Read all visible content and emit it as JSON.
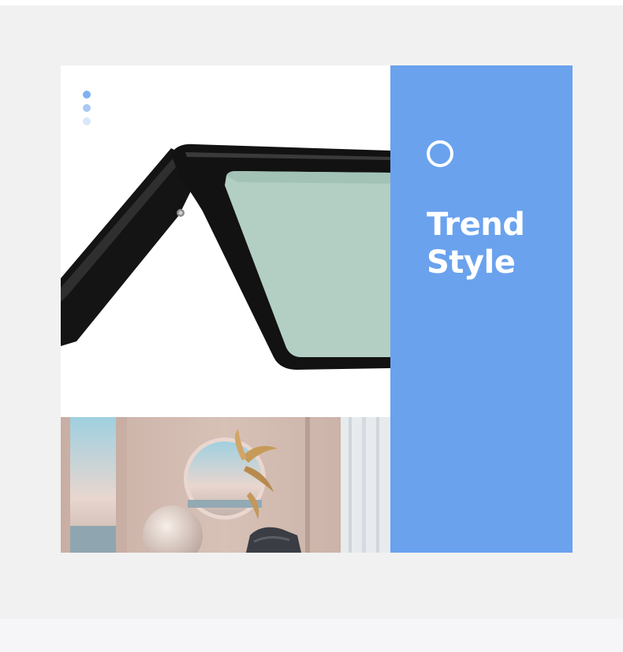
{
  "colors": {
    "accent": "#6aa2ee",
    "page_background": "#f1f1f1",
    "dot_1": "#7fb0f0",
    "dot_2": "#a9c9f5",
    "dot_3": "#d8e7fb"
  },
  "panel": {
    "icon": "circle-outline-icon",
    "title_line_1": "Trend",
    "title_line_2": "Style"
  }
}
